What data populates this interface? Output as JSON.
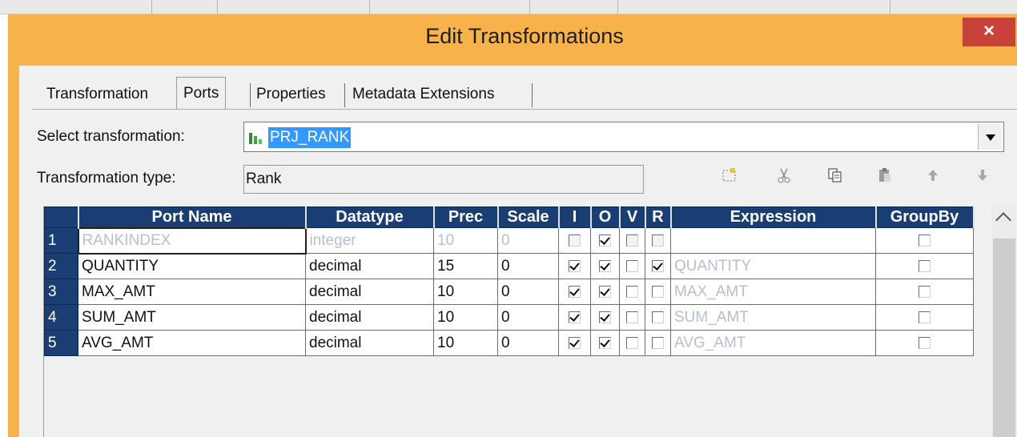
{
  "window": {
    "title": "Edit Transformations",
    "close_label": "×"
  },
  "tabs": [
    {
      "label": "Transformation"
    },
    {
      "label": "Ports"
    },
    {
      "label": "Properties"
    },
    {
      "label": "Metadata Extensions"
    }
  ],
  "form": {
    "select_label": "Select transformation:",
    "select_value": "PRJ_RANK",
    "type_label": "Transformation type:",
    "type_value": "Rank"
  },
  "toolbar": {
    "icons": [
      "new-port-icon",
      "cut-icon",
      "copy-icon",
      "paste-icon",
      "move-up-icon",
      "move-down-icon"
    ]
  },
  "grid": {
    "columns": [
      "Port Name",
      "Datatype",
      "Prec",
      "Scale",
      "I",
      "O",
      "V",
      "R",
      "Expression",
      "GroupBy"
    ],
    "rows": [
      {
        "num": "1",
        "name": "RANKINDEX",
        "datatype": "integer",
        "prec": "10",
        "scale": "0",
        "i": false,
        "o": true,
        "v": false,
        "r": false,
        "expression": "",
        "groupby": false,
        "dim": true
      },
      {
        "num": "2",
        "name": "QUANTITY",
        "datatype": "decimal",
        "prec": "15",
        "scale": "0",
        "i": true,
        "o": true,
        "v": false,
        "r": true,
        "expression": "QUANTITY",
        "groupby": false,
        "dim": false
      },
      {
        "num": "3",
        "name": "MAX_AMT",
        "datatype": "decimal",
        "prec": "10",
        "scale": "0",
        "i": true,
        "o": true,
        "v": false,
        "r": false,
        "expression": "MAX_AMT",
        "groupby": false,
        "dim": false
      },
      {
        "num": "4",
        "name": "SUM_AMT",
        "datatype": "decimal",
        "prec": "10",
        "scale": "0",
        "i": true,
        "o": true,
        "v": false,
        "r": false,
        "expression": "SUM_AMT",
        "groupby": false,
        "dim": false
      },
      {
        "num": "5",
        "name": "AVG_AMT",
        "datatype": "decimal",
        "prec": "10",
        "scale": "0",
        "i": true,
        "o": true,
        "v": false,
        "r": false,
        "expression": "AVG_AMT",
        "groupby": false,
        "dim": false
      }
    ]
  },
  "colors": {
    "title_bar": "#f7b24b",
    "close_button": "#c9423a",
    "grid_header": "#1a3e73",
    "selection": "#3399ff"
  }
}
